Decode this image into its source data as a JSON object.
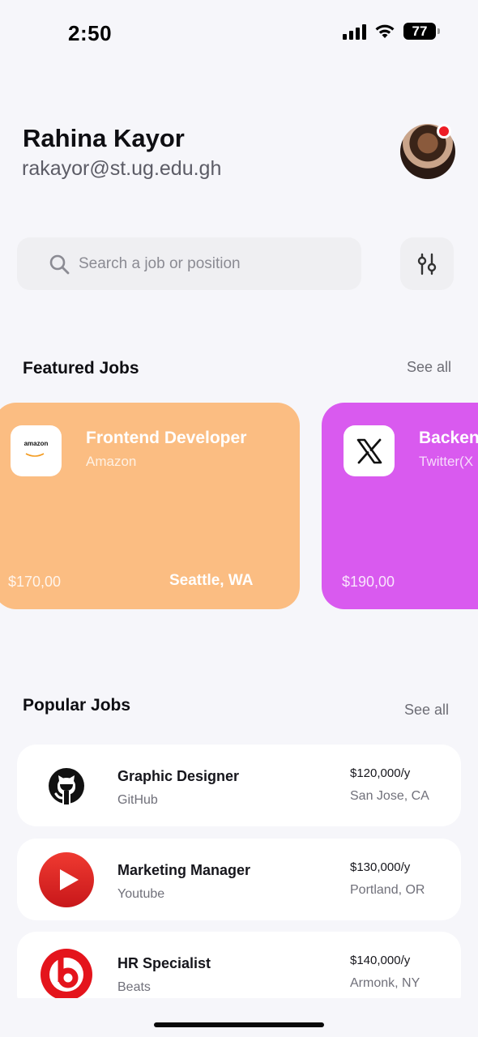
{
  "status_bar": {
    "time": "2:50",
    "battery": "77"
  },
  "user": {
    "name": "Rahina Kayor",
    "email": "rakayor@st.ug.edu.gh"
  },
  "search": {
    "placeholder": "Search a job or position"
  },
  "featured": {
    "title": "Featured Jobs",
    "see_all": "See all",
    "jobs": [
      {
        "title": "Frontend Developer",
        "company": "Amazon",
        "salary": "$170,00",
        "location": "Seattle, WA",
        "logo_word": "amazon",
        "color": "#fbbd82"
      },
      {
        "title": "Backen",
        "company": "Twitter(X",
        "salary": "$190,00",
        "color": "#d95aef"
      }
    ]
  },
  "popular": {
    "title": "Popular Jobs",
    "see_all": "See all",
    "jobs": [
      {
        "title": "Graphic Designer",
        "company": "GitHub",
        "salary": "$120,000/y",
        "location": "San Jose, CA"
      },
      {
        "title": "Marketing Manager",
        "company": "Youtube",
        "salary": "$130,000/y",
        "location": "Portland, OR"
      },
      {
        "title": "HR Specialist",
        "company": "Beats",
        "salary": "$140,000/y",
        "location": "Armonk, NY"
      }
    ]
  },
  "icons": {
    "search": "search-icon",
    "filter": "sliders-icon",
    "github": "github-icon",
    "youtube": "youtube-icon",
    "beats": "beats-icon",
    "x": "x-logo-icon",
    "amazon": "amazon-logo-icon"
  },
  "colors": {
    "featured_orange": "#fbbd82",
    "featured_purple": "#d95aef",
    "notification": "#ee1c24",
    "youtube_red": "#e0211e",
    "beats_red": "#e4141c"
  }
}
